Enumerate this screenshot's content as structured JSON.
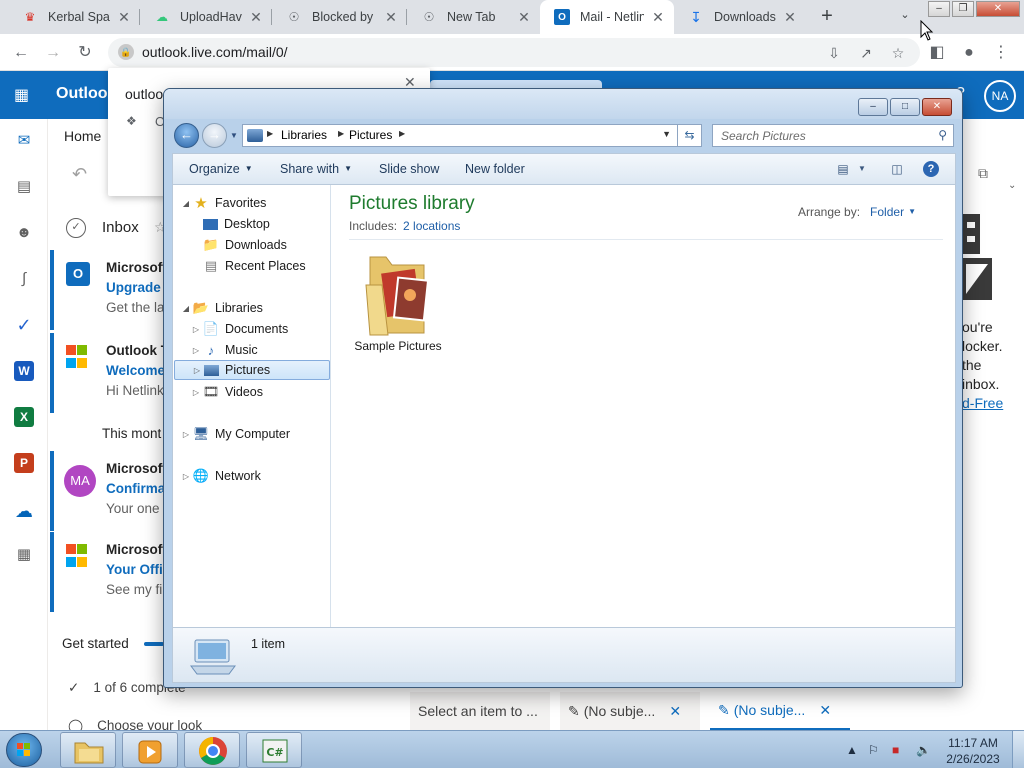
{
  "browser": {
    "tabs": [
      {
        "title": "Kerbal Space",
        "icon": "kerbal-favicon"
      },
      {
        "title": "UploadHaven",
        "icon": "uploadhaven-favicon"
      },
      {
        "title": "Blocked by C",
        "icon": "chrome-favicon"
      },
      {
        "title": "New Tab",
        "icon": "chrome-favicon"
      },
      {
        "title": "Mail - Netlin",
        "icon": "outlook-favicon",
        "active": true
      },
      {
        "title": "Downloads",
        "icon": "download-favicon"
      }
    ],
    "tab_close": "✕",
    "new_tab": "+",
    "url": "outlook.live.com/mail/0/"
  },
  "outlook": {
    "brand": "Outloo",
    "avatar": "NA",
    "home": "Home",
    "inbox": "Inbox",
    "mails": [
      {
        "from": "Microsoft",
        "subject": "Upgrade T",
        "preview": "Get the la"
      },
      {
        "from": "Outlook T",
        "subject": "Welcome",
        "preview": "Hi Netlink"
      },
      {
        "from": "Microsoft",
        "subject": "Confirmat",
        "preview": "Your one a",
        "avatar": "MA"
      },
      {
        "from": "Microsoft",
        "subject": "Your Offic",
        "preview": "See my fil"
      }
    ],
    "month_header": "This mont",
    "get_started": "Get started",
    "completed": "1 of 6 complete",
    "choose": "Choose your look",
    "side_lines": [
      "ou're",
      "locker.",
      "the",
      "inbox."
    ],
    "side_link": "d-Free",
    "bottom_tabs": [
      "Select an item to ...",
      "(No subje...",
      "(No subje..."
    ]
  },
  "popup": {
    "title": "outloo",
    "item": "O"
  },
  "explorer": {
    "breadcrumb": [
      "Libraries",
      "Pictures"
    ],
    "search_placeholder": "Search Pictures",
    "commands": {
      "organize": "Organize",
      "share": "Share with",
      "slideshow": "Slide show",
      "new_folder": "New folder"
    },
    "nav": {
      "favorites": "Favorites",
      "desktop": "Desktop",
      "downloads": "Downloads",
      "recent": "Recent Places",
      "libraries": "Libraries",
      "documents": "Documents",
      "music": "Music",
      "pictures": "Pictures",
      "videos": "Videos",
      "computer": "My Computer",
      "network": "Network"
    },
    "library_title": "Pictures library",
    "includes_label": "Includes:",
    "includes_link": "2 locations",
    "arrange_label": "Arrange by:",
    "arrange_value": "Folder",
    "items": [
      {
        "name": "Sample Pictures"
      }
    ],
    "status": "1 item"
  },
  "taskbar": {
    "time": "11:17 AM",
    "date": "2/26/2023",
    "apps": [
      "windows-explorer-icon",
      "media-player-icon",
      "chrome-icon",
      "csharp-icon"
    ]
  },
  "colors": {
    "outlook_blue": "#0f6cbd",
    "library_title_green": "#1e7b2e"
  }
}
